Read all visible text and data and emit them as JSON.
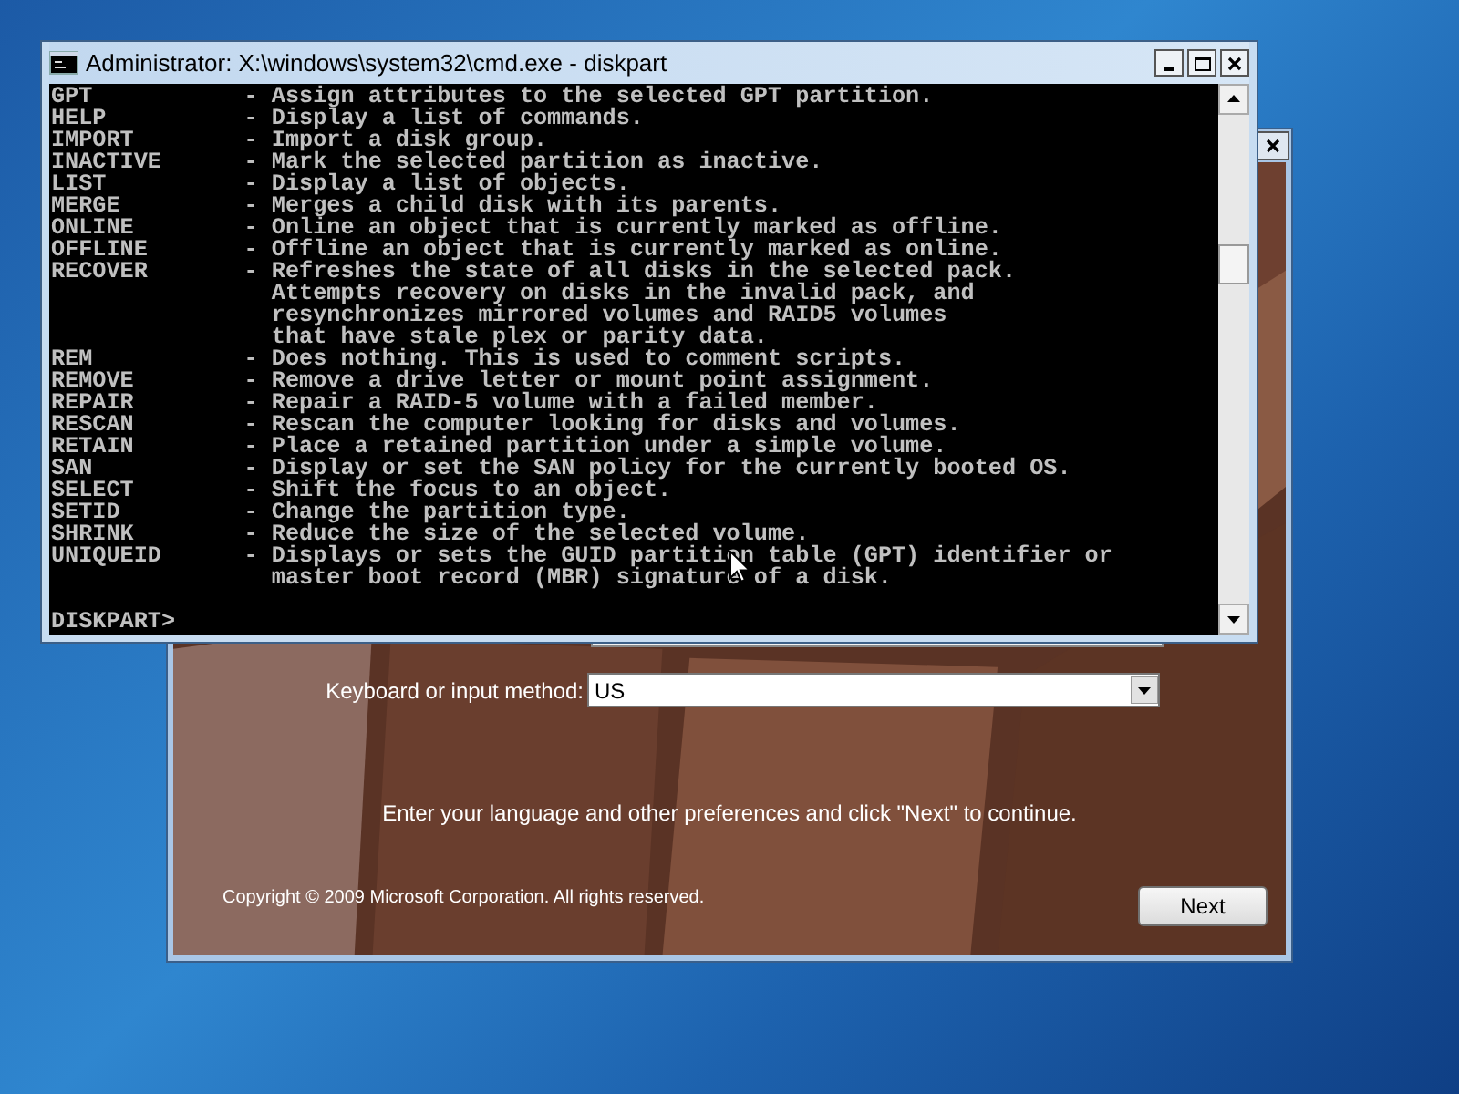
{
  "setup_window": {
    "keyboard_label": "Keyboard or input method:",
    "keyboard_value": "US",
    "message": "Enter your language and other preferences and click \"Next\" to continue.",
    "copyright": "Copyright © 2009 Microsoft Corporation. All rights reserved.",
    "next_button": "Next"
  },
  "console_window": {
    "title": "Administrator: X:\\windows\\system32\\cmd.exe - diskpart",
    "entries": [
      {
        "command": "GPT",
        "lines": [
          "- Assign attributes to the selected GPT partition."
        ]
      },
      {
        "command": "HELP",
        "lines": [
          "- Display a list of commands."
        ]
      },
      {
        "command": "IMPORT",
        "lines": [
          "- Import a disk group."
        ]
      },
      {
        "command": "INACTIVE",
        "lines": [
          "- Mark the selected partition as inactive."
        ]
      },
      {
        "command": "LIST",
        "lines": [
          "- Display a list of objects."
        ]
      },
      {
        "command": "MERGE",
        "lines": [
          "- Merges a child disk with its parents."
        ]
      },
      {
        "command": "ONLINE",
        "lines": [
          "- Online an object that is currently marked as offline."
        ]
      },
      {
        "command": "OFFLINE",
        "lines": [
          "- Offline an object that is currently marked as online."
        ]
      },
      {
        "command": "RECOVER",
        "lines": [
          "- Refreshes the state of all disks in the selected pack.",
          "Attempts recovery on disks in the invalid pack, and",
          "resynchronizes mirrored volumes and RAID5 volumes",
          "that have stale plex or parity data."
        ]
      },
      {
        "command": "REM",
        "lines": [
          "- Does nothing. This is used to comment scripts."
        ]
      },
      {
        "command": "REMOVE",
        "lines": [
          "- Remove a drive letter or mount point assignment."
        ]
      },
      {
        "command": "REPAIR",
        "lines": [
          "- Repair a RAID-5 volume with a failed member."
        ]
      },
      {
        "command": "RESCAN",
        "lines": [
          "- Rescan the computer looking for disks and volumes."
        ]
      },
      {
        "command": "RETAIN",
        "lines": [
          "- Place a retained partition under a simple volume."
        ]
      },
      {
        "command": "SAN",
        "lines": [
          "- Display or set the SAN policy for the currently booted OS."
        ]
      },
      {
        "command": "SELECT",
        "lines": [
          "- Shift the focus to an object."
        ]
      },
      {
        "command": "SETID",
        "lines": [
          "- Change the partition type."
        ]
      },
      {
        "command": "SHRINK",
        "lines": [
          "- Reduce the size of the selected volume."
        ]
      },
      {
        "command": "UNIQUEID",
        "lines": [
          "- Displays or sets the GUID partition table (GPT) identifier or",
          "master boot record (MBR) signature of a disk."
        ]
      }
    ],
    "prompt": "DISKPART>"
  }
}
